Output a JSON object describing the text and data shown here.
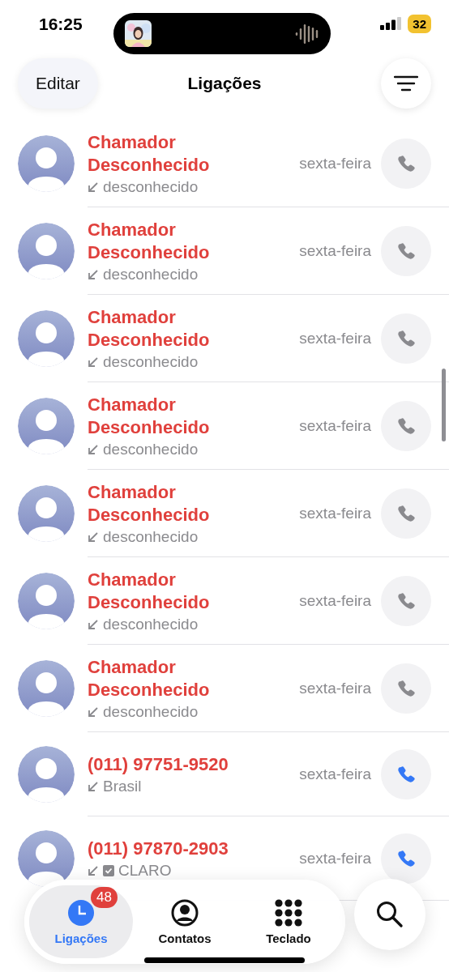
{
  "status_bar": {
    "time": "16:25",
    "battery": "32"
  },
  "header": {
    "edit_button": "Editar",
    "title": "Ligações"
  },
  "calls": [
    {
      "name": "Chamador Desconhecido",
      "detail": "desconhecido",
      "date": "sexta-feira",
      "verified": false,
      "disabled": true
    },
    {
      "name": "Chamador Desconhecido",
      "detail": "desconhecido",
      "date": "sexta-feira",
      "verified": false,
      "disabled": true
    },
    {
      "name": "Chamador Desconhecido",
      "detail": "desconhecido",
      "date": "sexta-feira",
      "verified": false,
      "disabled": true
    },
    {
      "name": "Chamador Desconhecido",
      "detail": "desconhecido",
      "date": "sexta-feira",
      "verified": false,
      "disabled": true
    },
    {
      "name": "Chamador Desconhecido",
      "detail": "desconhecido",
      "date": "sexta-feira",
      "verified": false,
      "disabled": true
    },
    {
      "name": "Chamador Desconhecido",
      "detail": "desconhecido",
      "date": "sexta-feira",
      "verified": false,
      "disabled": true
    },
    {
      "name": "Chamador Desconhecido",
      "detail": "desconhecido",
      "date": "sexta-feira",
      "verified": false,
      "disabled": true
    },
    {
      "name": "(011) 97751-9520",
      "detail": "Brasil",
      "date": "sexta-feira",
      "verified": false,
      "disabled": false
    },
    {
      "name": "(011) 97870-2903",
      "detail": "CLARO",
      "date": "sexta-feira",
      "verified": true,
      "disabled": false
    }
  ],
  "tab_bar": {
    "tabs": [
      {
        "label": "Ligações",
        "selected": true,
        "badge": "48"
      },
      {
        "label": "Contatos",
        "selected": false
      },
      {
        "label": "Teclado",
        "selected": false
      }
    ]
  }
}
